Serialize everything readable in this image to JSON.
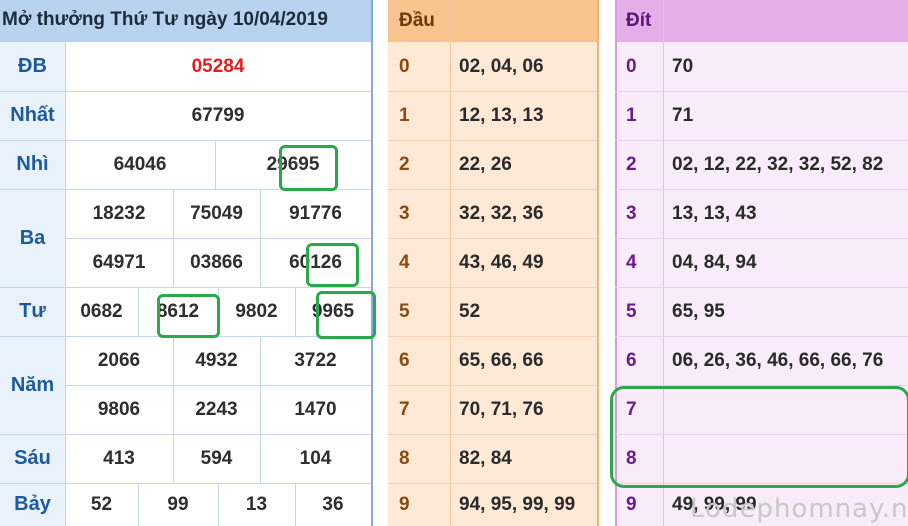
{
  "results": {
    "title": "Mở thưởng Thứ Tư ngày 10/04/2019",
    "prizes": {
      "db": {
        "label": "ĐB",
        "values": [
          "05284"
        ]
      },
      "nhat": {
        "label": "Nhất",
        "values": [
          "67799"
        ]
      },
      "nhi": {
        "label": "Nhì",
        "values": [
          "64046",
          "29695"
        ]
      },
      "ba": {
        "label": "Ba",
        "values": [
          "18232",
          "75049",
          "91776",
          "64971",
          "03866",
          "60126"
        ]
      },
      "tu": {
        "label": "Tư",
        "values": [
          "0682",
          "8612",
          "9802",
          "9965"
        ]
      },
      "nam": {
        "label": "Năm",
        "values": [
          "2066",
          "4932",
          "3722",
          "9806",
          "2243",
          "1470"
        ]
      },
      "sau": {
        "label": "Sáu",
        "values": [
          "413",
          "594",
          "104"
        ]
      },
      "bay": {
        "label": "Bảy",
        "values": [
          "52",
          "99",
          "13",
          "36"
        ]
      }
    },
    "highlighted": [
      "29695",
      "60126",
      "8612",
      "9965"
    ]
  },
  "dau_table": {
    "header": "Đầu",
    "rows": [
      {
        "digit": "0",
        "values": "02, 04, 06"
      },
      {
        "digit": "1",
        "values": "12, 13, 13"
      },
      {
        "digit": "2",
        "values": "22, 26"
      },
      {
        "digit": "3",
        "values": "32, 32, 36"
      },
      {
        "digit": "4",
        "values": "43, 46, 49"
      },
      {
        "digit": "5",
        "values": "52"
      },
      {
        "digit": "6",
        "values": "65, 66, 66"
      },
      {
        "digit": "7",
        "values": "70, 71, 76"
      },
      {
        "digit": "8",
        "values": "82, 84"
      },
      {
        "digit": "9",
        "values": "94, 95, 99, 99"
      }
    ]
  },
  "dit_table": {
    "header": "Đít",
    "rows": [
      {
        "digit": "0",
        "values": "70"
      },
      {
        "digit": "1",
        "values": "71"
      },
      {
        "digit": "2",
        "values": "02, 12, 22, 32, 32, 52, 82"
      },
      {
        "digit": "3",
        "values": "13, 13, 43"
      },
      {
        "digit": "4",
        "values": "04, 84, 94"
      },
      {
        "digit": "5",
        "values": "65, 95"
      },
      {
        "digit": "6",
        "values": "06, 26, 36, 46, 66, 66, 76"
      },
      {
        "digit": "7",
        "values": ""
      },
      {
        "digit": "8",
        "values": ""
      },
      {
        "digit": "9",
        "values": "49, 99, 99"
      }
    ]
  },
  "watermark": "Lodephomnay.net",
  "colors": {
    "results_header": "#b9d2f0",
    "label_text": "#1c5aa0",
    "special_prize": "#e02020",
    "dau_header": "#f7c48d",
    "dau_body": "#fde9d5",
    "dau_text": "#8a4a12",
    "dit_header": "#e4aee8",
    "dit_body": "#f9ecfa",
    "dit_text": "#6d1a8a",
    "highlight": "#2ba84a"
  }
}
